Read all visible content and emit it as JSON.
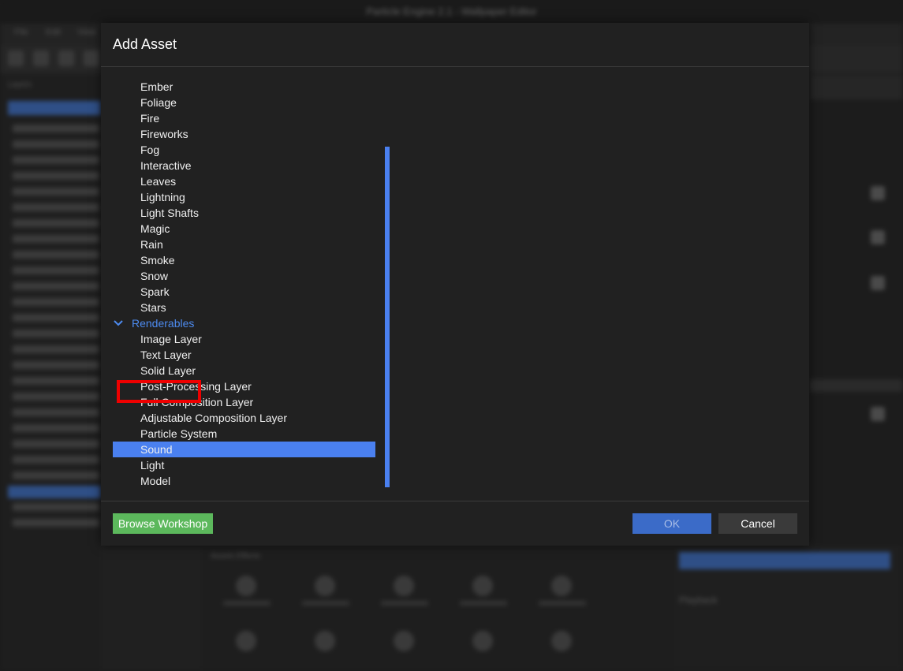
{
  "background": {
    "window_title": "Particle Engine 2.1 - Wallpaper Editor",
    "menu_items": [
      "File",
      "Edit",
      "View"
    ],
    "left_tabs": "Layers",
    "bottom_tabs": "Assets   Effects",
    "playback_label": "Playback"
  },
  "dialog": {
    "title": "Add Asset",
    "tree_items": [
      {
        "label": "Ember",
        "type": "item"
      },
      {
        "label": "Foliage",
        "type": "item"
      },
      {
        "label": "Fire",
        "type": "item"
      },
      {
        "label": "Fireworks",
        "type": "item"
      },
      {
        "label": "Fog",
        "type": "item"
      },
      {
        "label": "Interactive",
        "type": "item"
      },
      {
        "label": "Leaves",
        "type": "item"
      },
      {
        "label": "Lightning",
        "type": "item"
      },
      {
        "label": "Light Shafts",
        "type": "item"
      },
      {
        "label": "Magic",
        "type": "item"
      },
      {
        "label": "Rain",
        "type": "item"
      },
      {
        "label": "Smoke",
        "type": "item"
      },
      {
        "label": "Snow",
        "type": "item"
      },
      {
        "label": "Spark",
        "type": "item"
      },
      {
        "label": "Stars",
        "type": "item"
      },
      {
        "label": "Renderables",
        "type": "category",
        "expanded": true
      },
      {
        "label": "Image Layer",
        "type": "item"
      },
      {
        "label": "Text Layer",
        "type": "item"
      },
      {
        "label": "Solid Layer",
        "type": "item"
      },
      {
        "label": "Post-Processing Layer",
        "type": "item"
      },
      {
        "label": "Full Composition Layer",
        "type": "item"
      },
      {
        "label": "Adjustable Composition Layer",
        "type": "item"
      },
      {
        "label": "Particle System",
        "type": "item"
      },
      {
        "label": "Sound",
        "type": "item",
        "selected": true
      },
      {
        "label": "Light",
        "type": "item"
      },
      {
        "label": "Model",
        "type": "item"
      }
    ],
    "buttons": {
      "browse_workshop": "Browse Workshop",
      "ok": "OK",
      "cancel": "Cancel"
    }
  },
  "colors": {
    "accent": "#4a80f0",
    "workshop_green": "#5cb85c",
    "highlight_red": "#ee0000"
  }
}
